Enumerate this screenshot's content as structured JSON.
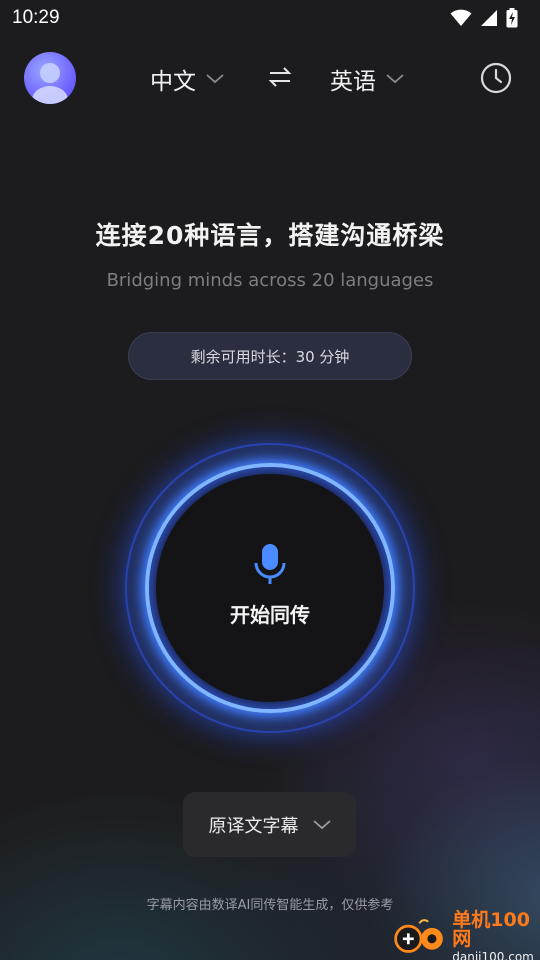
{
  "status_bar": {
    "time": "10:29",
    "icons": [
      "wifi-icon",
      "signal-icon",
      "battery-charging-icon"
    ]
  },
  "top_bar": {
    "avatar_icon": "user-avatar-icon",
    "source_language": "中文",
    "target_language": "英语",
    "swap_icon": "swap-arrows-icon",
    "history_icon": "clock-icon"
  },
  "hero": {
    "title": "连接20种语言，搭建沟通桥梁",
    "subtitle": "Bridging minds across 20 languages",
    "remaining_time": "剩余可用时长：30 分钟"
  },
  "mic_button": {
    "label": "开始同传",
    "icon": "microphone-icon"
  },
  "subtitle_mode": {
    "label": "原译文字幕",
    "icon": "chevron-down-icon"
  },
  "footer": {
    "disclaimer": "字幕内容由数译AI同传智能生成，仅供参考"
  },
  "watermark": {
    "cn": "单机100网",
    "en": "danji100.com"
  },
  "colors": {
    "background": "#1c1c1e",
    "ring_glow": "#3f7dff",
    "ring_core": "#7fb6ff",
    "mic": "#4a8bff",
    "watermark": "#ff7a1a"
  }
}
